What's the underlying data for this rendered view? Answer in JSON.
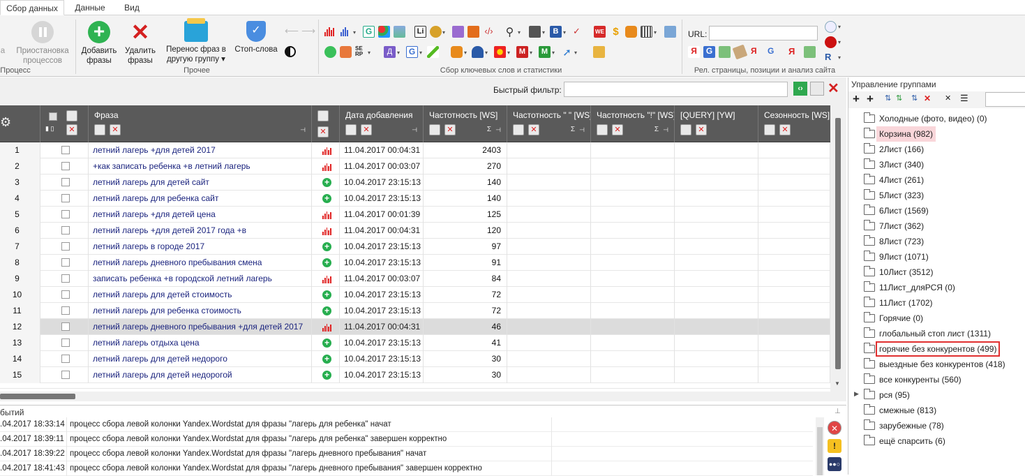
{
  "tabs": [
    "Сбор данных",
    "Данные",
    "Вид"
  ],
  "ribbon": {
    "process": {
      "a_label": "а",
      "pause_l1": "Приостановка",
      "pause_l2": "процессов",
      "group": "Процесс"
    },
    "other": {
      "add_l1": "Добавить",
      "add_l2": "фразы",
      "del_l1": "Удалить",
      "del_l2": "фразы",
      "move_l1": "Перенос фраз в",
      "move_l2": "другую группу",
      "stop": "Стоп-слова",
      "group": "Прочее"
    },
    "keywords_group": "Сбор ключевых слов и статистики",
    "rel_group": "Рел. страницы, позиции и анализ сайта",
    "url_label": "URL:",
    "url_value": ""
  },
  "filter": {
    "label": "Быстрый фильтр:",
    "value": ""
  },
  "grid": {
    "headers": [
      "Фраза",
      "Дата добавления",
      "Частотность [WS]",
      "Частотность \" \" [WS]",
      "Частотность \"!\" [WS]",
      "[QUERY] [YW]",
      "Сезонность [WS]"
    ],
    "sigma": "Σ",
    "rows": [
      {
        "n": "1",
        "phrase": "летний лагерь +для детей 2017",
        "src": "bars",
        "date": "11.04.2017 00:04:31",
        "ws": "2403"
      },
      {
        "n": "2",
        "phrase": "+как записать ребенка +в летний лагерь",
        "src": "bars",
        "date": "11.04.2017 00:03:07",
        "ws": "270"
      },
      {
        "n": "3",
        "phrase": "летний лагерь для детей сайт",
        "src": "plus",
        "date": "10.04.2017 23:15:13",
        "ws": "140"
      },
      {
        "n": "4",
        "phrase": "летний лагерь для ребенка сайт",
        "src": "plus",
        "date": "10.04.2017 23:15:13",
        "ws": "140"
      },
      {
        "n": "5",
        "phrase": "летний лагерь +для детей цена",
        "src": "bars",
        "date": "11.04.2017 00:01:39",
        "ws": "125"
      },
      {
        "n": "6",
        "phrase": "летний лагерь +для детей 2017 года +в",
        "src": "bars",
        "date": "11.04.2017 00:04:31",
        "ws": "120"
      },
      {
        "n": "7",
        "phrase": "летний лагерь в городе 2017",
        "src": "plus",
        "date": "10.04.2017 23:15:13",
        "ws": "97"
      },
      {
        "n": "8",
        "phrase": "летний лагерь дневного пребывания смена",
        "src": "plus",
        "date": "10.04.2017 23:15:13",
        "ws": "91"
      },
      {
        "n": "9",
        "phrase": "записать ребенка +в городской летний лагерь",
        "src": "bars",
        "date": "11.04.2017 00:03:07",
        "ws": "84"
      },
      {
        "n": "10",
        "phrase": "летний лагерь для детей стоимость",
        "src": "plus",
        "date": "10.04.2017 23:15:13",
        "ws": "72"
      },
      {
        "n": "11",
        "phrase": "летний лагерь для ребенка стоимость",
        "src": "plus",
        "date": "10.04.2017 23:15:13",
        "ws": "72"
      },
      {
        "n": "12",
        "phrase": "летний лагерь дневного пребывания +для детей 2017",
        "src": "bars",
        "date": "11.04.2017 00:04:31",
        "ws": "46"
      },
      {
        "n": "13",
        "phrase": "летний лагерь отдыха цена",
        "src": "plus",
        "date": "10.04.2017 23:15:13",
        "ws": "41"
      },
      {
        "n": "14",
        "phrase": "летний лагерь для детей недорого",
        "src": "plus",
        "date": "10.04.2017 23:15:13",
        "ws": "30"
      },
      {
        "n": "15",
        "phrase": "летний лагерь для детей недорогой",
        "src": "plus",
        "date": "10.04.2017 23:15:13",
        "ws": "30"
      }
    ],
    "selected_row": 12
  },
  "log": {
    "title": "бытий",
    "lines": [
      {
        "ts": ".04.2017 18:33:14",
        "msg": "процесс сбора левой колонки Yandex.Wordstat для фразы \"лагерь для ребенка\" начат"
      },
      {
        "ts": ".04.2017 18:39:11",
        "msg": "процесс сбора левой колонки Yandex.Wordstat для фразы \"лагерь для ребенка\" завершен корректно"
      },
      {
        "ts": ".04.2017 18:39:22",
        "msg": "процесс сбора левой колонки Yandex.Wordstat для фразы \"лагерь дневного пребывания\" начат"
      },
      {
        "ts": ".04.2017 18:41:43",
        "msg": "процесс сбора левой колонки Yandex.Wordstat для фразы \"лагерь дневного пребывания\" завершен корректно"
      }
    ]
  },
  "groups": {
    "title": "Управление группами",
    "items": [
      "Холодные (фото, видео) (0)",
      "Корзина (982)",
      "2Лист (166)",
      "3Лист (340)",
      "4Лист (261)",
      "5Лист (323)",
      "6Лист (1569)",
      "7Лист (362)",
      "8Лист (723)",
      "9Лист (1071)",
      "10Лист (3512)",
      "11Лист_дляРСЯ (0)",
      "11Лист (1702)",
      "Горячие (0)",
      "глобальный стоп лист (1311)",
      "горячие без конкурентов (499)",
      "выездные без конкурентов (418)",
      "все конкуренты (560)",
      "рся (95)",
      "смежные (813)",
      "зарубежные (78)",
      "ещё спарсить (6)"
    ],
    "highlight_pink": 1,
    "highlight_boxed": 15,
    "expandable": 18
  },
  "colors": {
    "header_bg": "#5a5a5a",
    "phrase": "#1a237e",
    "accent_green": "#27ae4f",
    "accent_red": "#e02020",
    "pink": "#f9d6da"
  }
}
